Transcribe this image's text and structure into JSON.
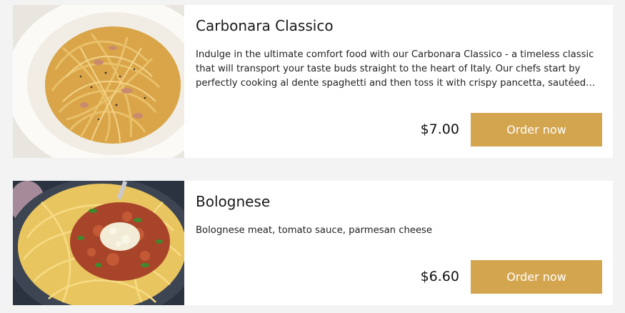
{
  "menu": {
    "items": [
      {
        "name": "Carbonara Classico",
        "description": "Indulge in the ultimate comfort food with our Carbonara Classico - a timeless classic that will transport your taste buds straight to the heart of Italy. Our chefs start by perfectly cooking al dente spaghetti and then toss it with crispy pancetta, sautéed onions, garlic and a creamy egg sauce.",
        "price": "$7.00",
        "order_label": "Order now"
      },
      {
        "name": "Bolognese",
        "description": "Bolognese meat, tomato sauce, parmesan cheese",
        "price": "$6.60",
        "order_label": "Order now"
      }
    ]
  },
  "colors": {
    "accent": "#d4a54f",
    "page_background": "#f3f3f3",
    "card_background": "#ffffff"
  }
}
